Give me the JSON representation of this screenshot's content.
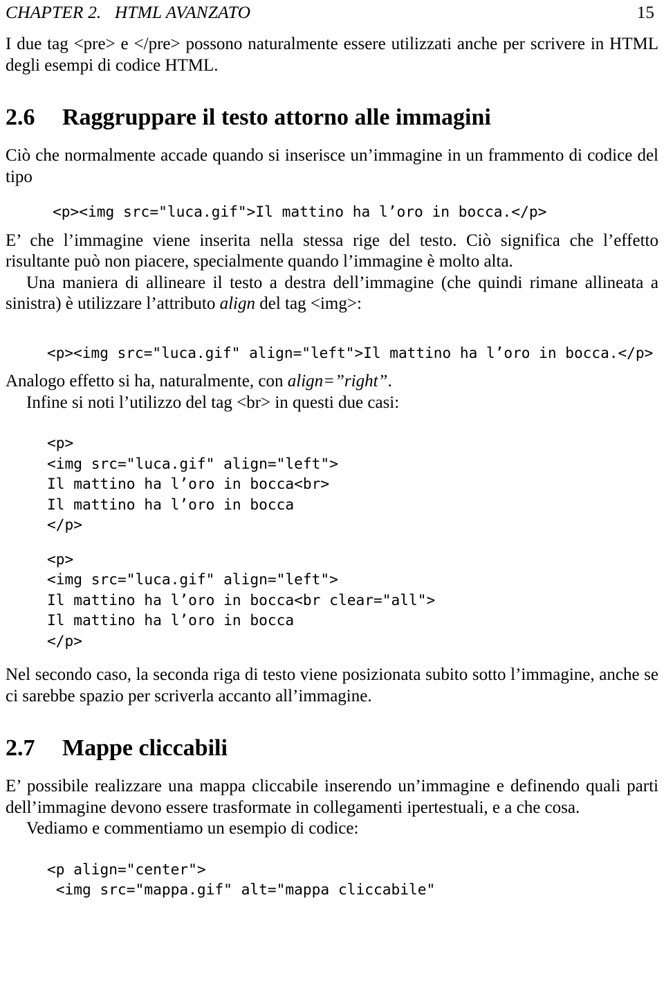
{
  "header": {
    "chapter_title": "CHAPTER 2.   HTML AVANZATO",
    "page_number": "15"
  },
  "intro_paragraph": "I due tag <pre> e </pre> possono naturalmente essere utilizzati anche per scrivere in HTML degli esempi di codice HTML.",
  "sections": [
    {
      "number": "2.6",
      "title": "Raggruppare il testo attorno alle immagini",
      "paragraphs": [
        "Ciò che normalmente accade quando si inserisce un’immagine in un frammento di codice del tipo",
        "E’ che l’immagine viene inserita nella stessa rige del testo. Ciò significa che l’effetto risultante può non piacere, specialmente quando l’immagine è molto alta.",
        "Una maniera di allineare il testo a destra dell’immagine (che quindi rimane allineata a sinistra) è utilizzare l’attributo align del tag <img>:",
        "Analogo effetto si ha, naturalmente, con align=”right”.",
        "Infine si noti l’utilizzo del tag <br> in questi due casi:",
        "Nel secondo caso, la seconda riga di testo viene posizionata subito sotto l’immagine, anche se ci sarebbe spazio per scriverla accanto all’immagine."
      ]
    },
    {
      "number": "2.7",
      "title": "Mappe cliccabili",
      "paragraphs": [
        "E’ possibile realizzare una mappa cliccabile inserendo un’immagine e definendo quali parti dell’immagine devono essere trasformate in collegamenti ipertestuali, e a che cosa.",
        "Vediamo e commentiamo un esempio di codice:"
      ]
    }
  ],
  "code_blocks": {
    "block1": "<p><img src=\"luca.gif\">Il mattino ha l’oro in bocca.</p>",
    "block2": "<p><img src=\"luca.gif\" align=\"left\">Il mattino ha l’oro in bocca.</p>",
    "block3": "<p>\n<img src=\"luca.gif\" align=\"left\">\nIl mattino ha l’oro in bocca<br>\nIl mattino ha l’oro in bocca\n</p>",
    "block4": "<p>\n<img src=\"luca.gif\" align=\"left\">\nIl mattino ha l’oro in bocca<br clear=\"all\">\nIl mattino ha l’oro in bocca\n</p>",
    "block5": "<p align=\"center\">\n <img src=\"mappa.gif\" alt=\"mappa cliccabile\""
  },
  "inline_italics": {
    "align": "align",
    "align_right": "align=”right”"
  },
  "inline_text": {
    "para3_before": "Una maniera di allineare il testo a destra dell’immagine (che quindi rimane allineata a sinistra) è utilizzare l’attributo ",
    "para3_after": " del tag <img>:",
    "para4_before": "Analogo effetto si ha, naturalmente, con ",
    "para4_after": "."
  }
}
